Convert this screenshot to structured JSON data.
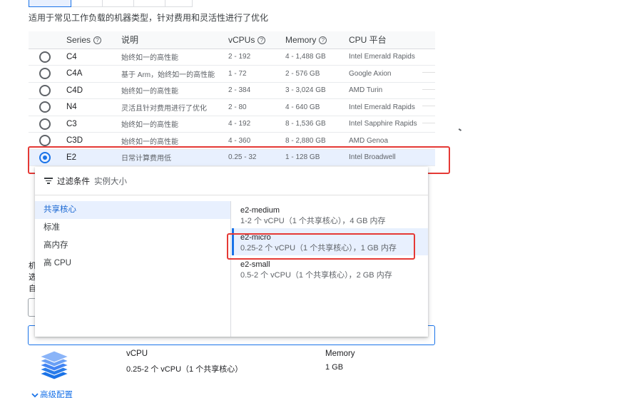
{
  "description": "适用于常见工作负载的机器类型，针对费用和灵活性进行了优化",
  "table": {
    "headers": {
      "series": "Series",
      "desc": "说明",
      "vcpus": "vCPUs",
      "memory": "Memory",
      "platform": "CPU 平台"
    },
    "help_glyph": "?",
    "rows": [
      {
        "name": "C4",
        "desc": "始终如一的高性能",
        "vcpus": "2 - 192",
        "memory": "4 - 1,488 GB",
        "platform": "Intel Emerald Rapids"
      },
      {
        "name": "C4A",
        "desc": "基于 Arm，始终如一的高性能",
        "vcpus": "1 - 72",
        "memory": "2 - 576 GB",
        "platform": "Google Axion"
      },
      {
        "name": "C4D",
        "desc": "始终如一的高性能",
        "vcpus": "2 - 384",
        "memory": "3 - 3,024 GB",
        "platform": "AMD Turin"
      },
      {
        "name": "N4",
        "desc": "灵活且针对费用进行了优化",
        "vcpus": "2 - 80",
        "memory": "4 - 640 GB",
        "platform": "Intel Emerald Rapids"
      },
      {
        "name": "C3",
        "desc": "始终如一的高性能",
        "vcpus": "4 - 192",
        "memory": "8 - 1,536 GB",
        "platform": "Intel Sapphire Rapids"
      },
      {
        "name": "C3D",
        "desc": "始终如一的高性能",
        "vcpus": "4 - 360",
        "memory": "8 - 2,880 GB",
        "platform": "AMD Genoa"
      },
      {
        "name": "E2",
        "desc": "日常计算费用低",
        "vcpus": "0.25 - 32",
        "memory": "1 - 128 GB",
        "platform": "Intel Broadwell",
        "selected": true
      }
    ]
  },
  "background_letters": [
    "机",
    "选",
    "自"
  ],
  "dropdown": {
    "filter_label": "过滤条件",
    "filter_sub": "实例大小",
    "categories": [
      "共享核心",
      "标准",
      "高内存",
      "高 CPU"
    ],
    "options": [
      {
        "title": "e2-medium",
        "sub": "1-2 个 vCPU（1 个共享核心），4 GB 内存"
      },
      {
        "title": "e2-micro",
        "sub": "0.25-2 个 vCPU（1 个共享核心），1 GB 内存",
        "active": true
      },
      {
        "title": "e2-small",
        "sub": "0.5-2 个 vCPU（1 个共享核心），2 GB 内存"
      }
    ]
  },
  "summary": {
    "vcpu_label": "vCPU",
    "vcpu_value": "0.25-2 个 vCPU（1 个共享核心）",
    "memory_label": "Memory",
    "memory_value": "1 GB"
  },
  "advanced_label": "高级配置",
  "advanced_icon": "chevron-down-icon",
  "colors": {
    "accent": "#1a73e8",
    "highlight": "#e53935",
    "selected_bg": "#e8f0fe"
  }
}
